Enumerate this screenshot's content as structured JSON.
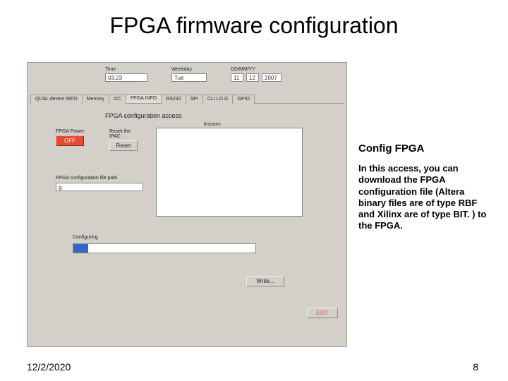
{
  "slide": {
    "title": "FPGA firmware configuration",
    "footer_date": "12/2/2020",
    "footer_page": "8"
  },
  "app": {
    "header": {
      "time_label": "Time",
      "time_value": "03.23",
      "weekday_label": "Weekday",
      "weekday_value": "Tue",
      "date_label": "DD/MM/YY",
      "date_dd": "11",
      "date_mm": "12",
      "date_yy": "2007"
    },
    "tabs": [
      "QUSL device INFO",
      "Memory",
      "I2C",
      "FPGA INFO",
      "RS232",
      "SPI",
      "CLI LO G",
      "GPIO"
    ],
    "panel_title": "FPGA configuration access",
    "lessons_label": "lessons",
    "fpga_power_label": "FPGA Power",
    "fpga_power_btn": "OFF",
    "reset_label": "Reset the IPAC",
    "reset_btn": "Reset",
    "path_label": "FPGA configuration file path",
    "path_value": "g",
    "configuring_label": "Configuring",
    "write_btn": "Write...",
    "exit_btn": "EXIT"
  },
  "sidebar": {
    "title": "Config FPGA",
    "body": " In this access, you can download the FPGA configuration file (Altera binary files are of type RBF and Xilinx are of type BIT. ) to the FPGA."
  }
}
